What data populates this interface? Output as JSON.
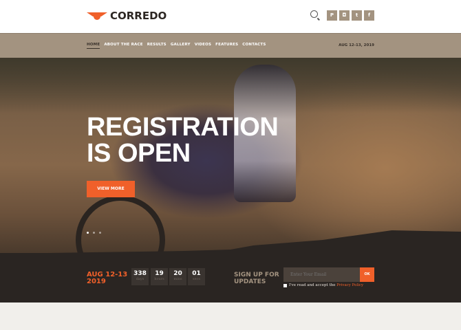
{
  "header": {
    "logo": "CORREDO",
    "social": [
      {
        "icon": "pinterest-icon",
        "glyph": "P"
      },
      {
        "icon": "instagram-icon",
        "glyph": "◘"
      },
      {
        "icon": "twitter-icon",
        "glyph": "t"
      },
      {
        "icon": "facebook-icon",
        "glyph": "f"
      }
    ]
  },
  "nav": {
    "items": [
      "HOME",
      "ABOUT THE RACE",
      "RESULTS",
      "GALLERY",
      "VIDEOS",
      "FEATURES",
      "CONTACTS"
    ],
    "date": "AUG 12-13, 2019"
  },
  "hero": {
    "line1": "REGISTRATION",
    "line2": "IS OPEN",
    "button": "VIEW MORE"
  },
  "band": {
    "date1": "AUG 12-13",
    "date2": "2019",
    "countdown": [
      {
        "value": "338",
        "label": "days"
      },
      {
        "value": "19",
        "label": "hours"
      },
      {
        "value": "20",
        "label": "mins"
      },
      {
        "value": "01",
        "label": "secs"
      }
    ],
    "signup1": "SIGN UP FOR",
    "signup2": "UPDATES",
    "email_placeholder": "Enter Your Email",
    "ok": "OK",
    "agree": "I've read and accept the ",
    "privacy": "Privacy Policy"
  },
  "colors": {
    "accent": "#f0602a",
    "tan": "#a39380",
    "dark": "#2a2522"
  }
}
